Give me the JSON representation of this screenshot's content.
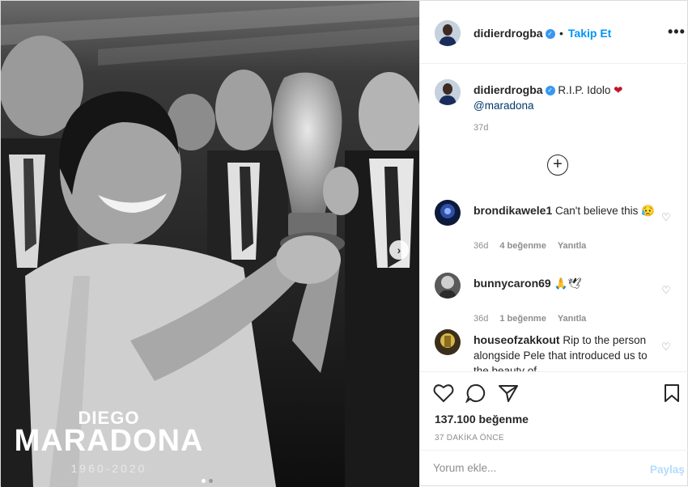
{
  "photo": {
    "overlay_first_name": "DIEGO",
    "overlay_last_name": "MARADONA",
    "overlay_years": "1960-2020"
  },
  "header": {
    "username": "didierdrogba",
    "separator": "•",
    "follow_label": "Takip Et",
    "more_label": "•••"
  },
  "caption": {
    "username": "didierdrogba",
    "text": "R.I.P. Idolo",
    "emoji": "❤",
    "mention": "@maradona",
    "time": "37d"
  },
  "comments": [
    {
      "username": "brondikawele1",
      "text": "Can't believe this",
      "emoji": "😥",
      "time": "36d",
      "likes": "4 beğenme",
      "reply": "Yanıtla"
    },
    {
      "username": "bunnycaron69",
      "text": "",
      "emoji": "🙏🕊",
      "time": "36d",
      "likes": "1 beğenme",
      "reply": "Yanıtla"
    },
    {
      "username": "houseofzakkout",
      "text": "Rip to the person alongside Pele that introduced us to the beauty of",
      "emoji": "",
      "time": "",
      "likes": "",
      "reply": ""
    }
  ],
  "actions": {
    "like_count": "137.100 beğenme",
    "time_ago": "37 DAKİKA ÖNCE"
  },
  "comment_box": {
    "placeholder": "Yorum ekle...",
    "share_label": "Paylaş"
  },
  "icons": {
    "like": "heart-icon",
    "comment": "comment-bubble-icon",
    "share": "paper-plane-icon",
    "save": "bookmark-icon"
  }
}
